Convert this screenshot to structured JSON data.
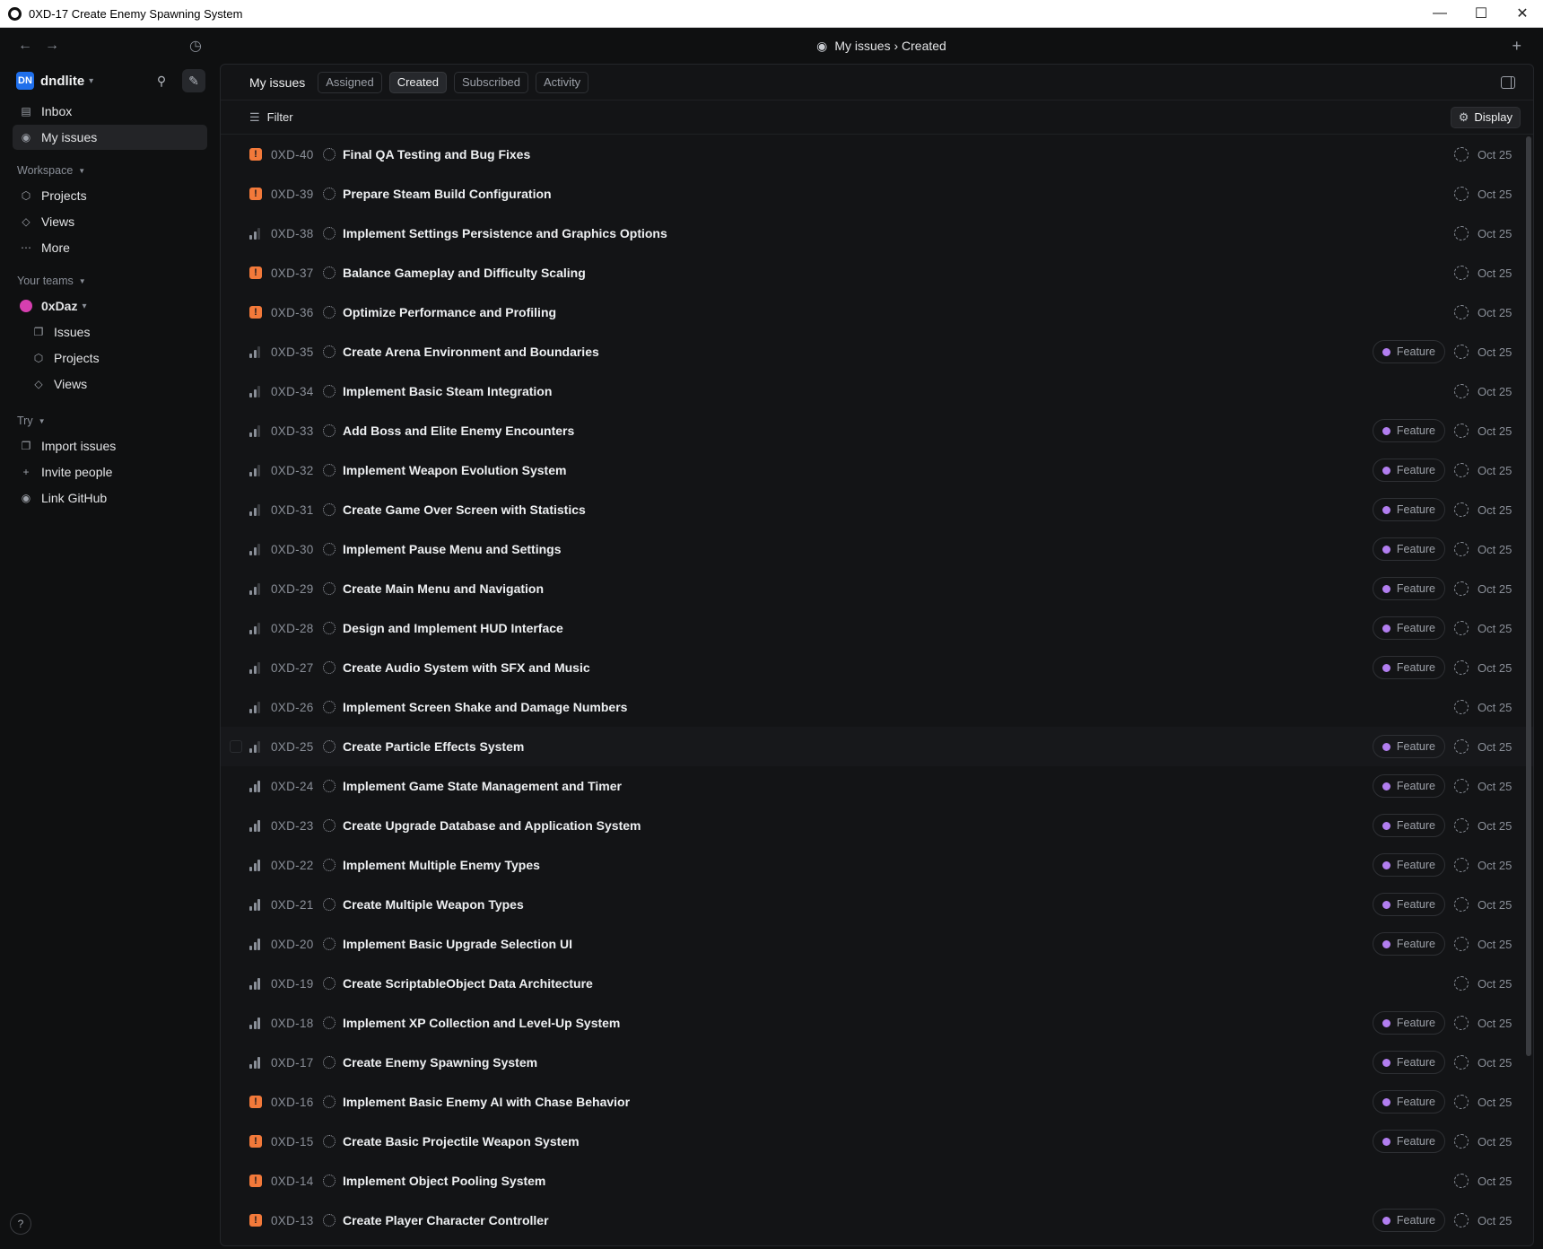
{
  "window": {
    "title": "0XD-17 Create Enemy Spawning System"
  },
  "header": {
    "breadcrumb": "My issues › Created"
  },
  "workspace": {
    "initials": "DN",
    "name": "dndlite"
  },
  "nav": {
    "inbox": "Inbox",
    "my_issues": "My issues"
  },
  "workspace_section": {
    "label": "Workspace",
    "projects": "Projects",
    "views": "Views",
    "more": "More"
  },
  "teams_section": {
    "label": "Your teams",
    "team_name": "0xDaz",
    "issues": "Issues",
    "projects": "Projects",
    "views": "Views"
  },
  "try_section": {
    "label": "Try",
    "import": "Import issues",
    "invite": "Invite people",
    "github": "Link GitHub"
  },
  "help": "?",
  "tabs": {
    "title": "My issues",
    "items": [
      "Assigned",
      "Created",
      "Subscribed",
      "Activity"
    ],
    "active": "Created"
  },
  "filter": {
    "label": "Filter",
    "display": "Display"
  },
  "colors": {
    "urgent": "#f2793a",
    "feature_dot": "#b27ef0"
  },
  "issues": [
    {
      "id": "0XD-40",
      "title": "Final QA Testing and Bug Fixes",
      "priority": "urgent",
      "label": "",
      "date": "Oct 25"
    },
    {
      "id": "0XD-39",
      "title": "Prepare Steam Build Configuration",
      "priority": "urgent",
      "label": "",
      "date": "Oct 25"
    },
    {
      "id": "0XD-38",
      "title": "Implement Settings Persistence and Graphics Options",
      "priority": "medium",
      "label": "",
      "date": "Oct 25"
    },
    {
      "id": "0XD-37",
      "title": "Balance Gameplay and Difficulty Scaling",
      "priority": "urgent",
      "label": "",
      "date": "Oct 25"
    },
    {
      "id": "0XD-36",
      "title": "Optimize Performance and Profiling",
      "priority": "urgent",
      "label": "",
      "date": "Oct 25"
    },
    {
      "id": "0XD-35",
      "title": "Create Arena Environment and Boundaries",
      "priority": "medium",
      "label": "Feature",
      "date": "Oct 25"
    },
    {
      "id": "0XD-34",
      "title": "Implement Basic Steam Integration",
      "priority": "medium",
      "label": "",
      "date": "Oct 25"
    },
    {
      "id": "0XD-33",
      "title": "Add Boss and Elite Enemy Encounters",
      "priority": "medium",
      "label": "Feature",
      "date": "Oct 25"
    },
    {
      "id": "0XD-32",
      "title": "Implement Weapon Evolution System",
      "priority": "medium",
      "label": "Feature",
      "date": "Oct 25"
    },
    {
      "id": "0XD-31",
      "title": "Create Game Over Screen with Statistics",
      "priority": "medium",
      "label": "Feature",
      "date": "Oct 25"
    },
    {
      "id": "0XD-30",
      "title": "Implement Pause Menu and Settings",
      "priority": "medium",
      "label": "Feature",
      "date": "Oct 25"
    },
    {
      "id": "0XD-29",
      "title": "Create Main Menu and Navigation",
      "priority": "medium",
      "label": "Feature",
      "date": "Oct 25"
    },
    {
      "id": "0XD-28",
      "title": "Design and Implement HUD Interface",
      "priority": "medium",
      "label": "Feature",
      "date": "Oct 25"
    },
    {
      "id": "0XD-27",
      "title": "Create Audio System with SFX and Music",
      "priority": "medium",
      "label": "Feature",
      "date": "Oct 25"
    },
    {
      "id": "0XD-26",
      "title": "Implement Screen Shake and Damage Numbers",
      "priority": "medium",
      "label": "",
      "date": "Oct 25"
    },
    {
      "id": "0XD-25",
      "title": "Create Particle Effects System",
      "priority": "medium",
      "label": "Feature",
      "date": "Oct 25"
    },
    {
      "id": "0XD-24",
      "title": "Implement Game State Management and Timer",
      "priority": "high",
      "label": "Feature",
      "date": "Oct 25"
    },
    {
      "id": "0XD-23",
      "title": "Create Upgrade Database and Application System",
      "priority": "high",
      "label": "Feature",
      "date": "Oct 25"
    },
    {
      "id": "0XD-22",
      "title": "Implement Multiple Enemy Types",
      "priority": "high",
      "label": "Feature",
      "date": "Oct 25"
    },
    {
      "id": "0XD-21",
      "title": "Create Multiple Weapon Types",
      "priority": "high",
      "label": "Feature",
      "date": "Oct 25"
    },
    {
      "id": "0XD-20",
      "title": "Implement Basic Upgrade Selection UI",
      "priority": "high",
      "label": "Feature",
      "date": "Oct 25"
    },
    {
      "id": "0XD-19",
      "title": "Create ScriptableObject Data Architecture",
      "priority": "high",
      "label": "",
      "date": "Oct 25"
    },
    {
      "id": "0XD-18",
      "title": "Implement XP Collection and Level-Up System",
      "priority": "high",
      "label": "Feature",
      "date": "Oct 25"
    },
    {
      "id": "0XD-17",
      "title": "Create Enemy Spawning System",
      "priority": "high",
      "label": "Feature",
      "date": "Oct 25"
    },
    {
      "id": "0XD-16",
      "title": "Implement Basic Enemy AI with Chase Behavior",
      "priority": "urgent",
      "label": "Feature",
      "date": "Oct 25"
    },
    {
      "id": "0XD-15",
      "title": "Create Basic Projectile Weapon System",
      "priority": "urgent",
      "label": "Feature",
      "date": "Oct 25"
    },
    {
      "id": "0XD-14",
      "title": "Implement Object Pooling System",
      "priority": "urgent",
      "label": "",
      "date": "Oct 25"
    },
    {
      "id": "0XD-13",
      "title": "Create Player Character Controller",
      "priority": "urgent",
      "label": "Feature",
      "date": "Oct 25"
    }
  ]
}
